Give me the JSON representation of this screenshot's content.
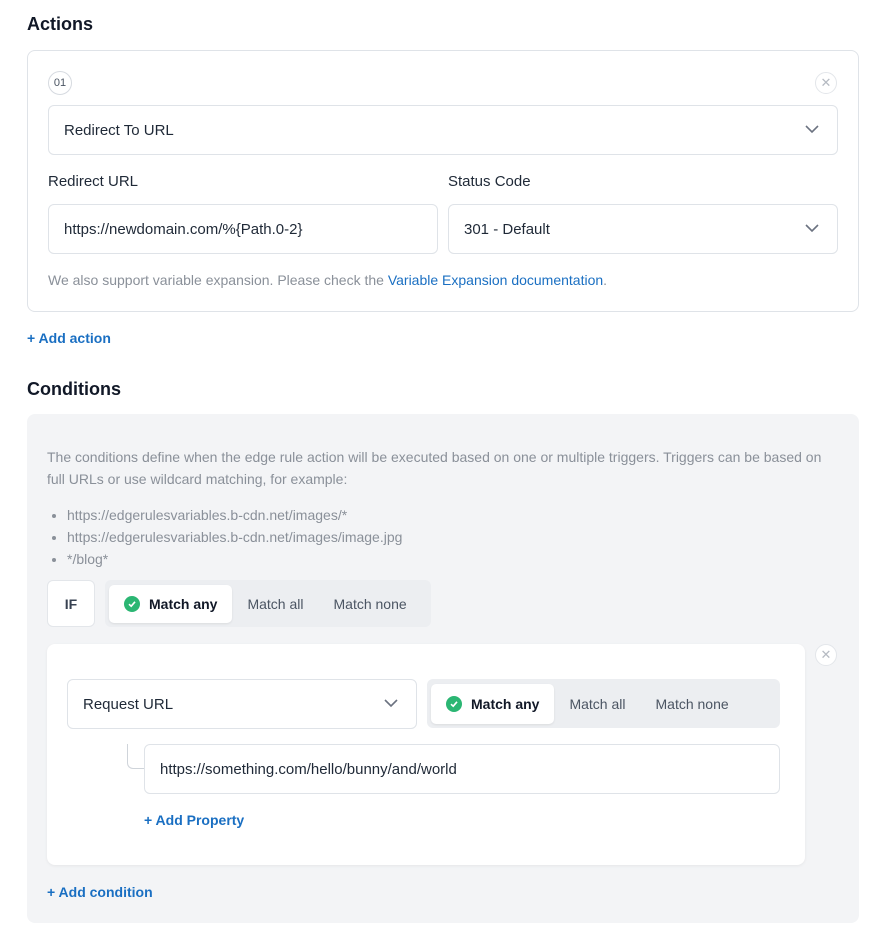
{
  "actions": {
    "title": "Actions",
    "item_number": "01",
    "action_type": "Redirect To URL",
    "redirect_url_label": "Redirect URL",
    "redirect_url_value": "https://newdomain.com/%{Path.0-2}",
    "status_code_label": "Status Code",
    "status_code_value": "301 - Default",
    "help_prefix": "We also support variable expansion. Please check the ",
    "help_link": "Variable Expansion documentation",
    "help_suffix": ".",
    "add_action": "+ Add action"
  },
  "conditions": {
    "title": "Conditions",
    "description": "The conditions define when the edge rule action will be executed based on one or multiple triggers. Triggers can be based on full URLs or use wildcard matching, for example:",
    "examples": [
      "https://edgerulesvariables.b-cdn.net/images/*",
      "https://edgerulesvariables.b-cdn.net/images/image.jpg",
      "*/blog*"
    ],
    "if_label": "IF",
    "match_options": [
      "Match any",
      "Match all",
      "Match none"
    ],
    "match_selected": "Match any",
    "condition": {
      "type": "Request URL",
      "match_options": [
        "Match any",
        "Match all",
        "Match none"
      ],
      "match_selected": "Match any",
      "value": "https://something.com/hello/bunny/and/world",
      "add_property": "+ Add Property"
    },
    "add_condition": "+ Add condition"
  },
  "colors": {
    "accent": "#1a6fc2",
    "check": "#2bb673"
  }
}
